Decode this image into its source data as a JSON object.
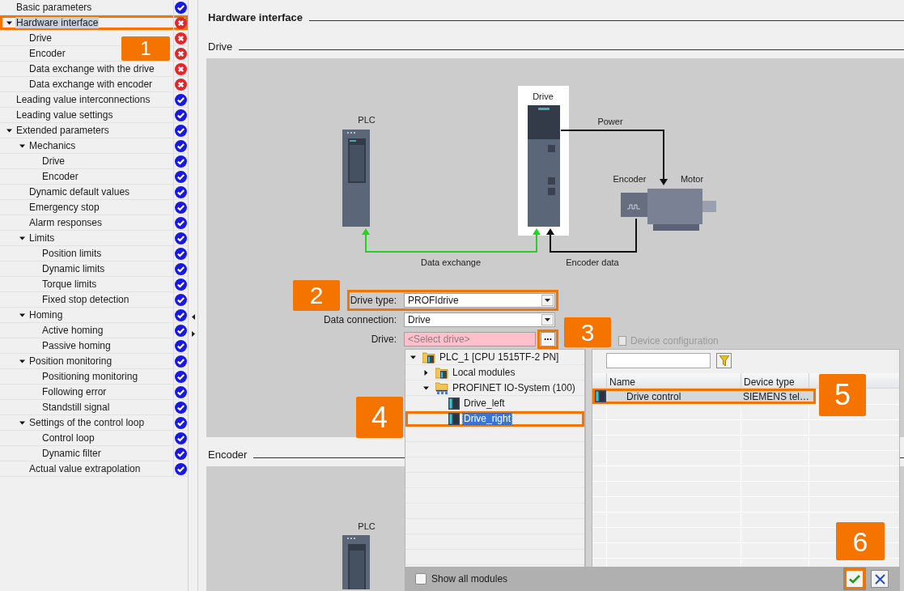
{
  "sidebar": {
    "items": [
      {
        "label": "Basic parameters",
        "error": false,
        "selected": false,
        "highlighted": false
      },
      {
        "label": "Hardware interface",
        "error": true,
        "selected": true,
        "highlighted": true,
        "expanded": true,
        "children": [
          {
            "label": "Drive",
            "error": true,
            "selected": false,
            "highlighted": false
          },
          {
            "label": "Encoder",
            "error": true,
            "selected": false,
            "highlighted": false
          },
          {
            "label": "Data exchange with the drive",
            "error": true,
            "selected": false,
            "highlighted": false
          },
          {
            "label": "Data exchange with encoder",
            "error": true,
            "selected": false,
            "highlighted": false
          }
        ]
      },
      {
        "label": "Leading value interconnections",
        "error": false,
        "selected": false,
        "highlighted": false
      },
      {
        "label": "Leading value settings",
        "error": false,
        "selected": false,
        "highlighted": false
      },
      {
        "label": "Extended parameters",
        "error": false,
        "selected": false,
        "highlighted": false,
        "expanded": true,
        "children": [
          {
            "label": "Mechanics",
            "error": false,
            "selected": false,
            "highlighted": false,
            "expanded": true,
            "children": [
              {
                "label": "Drive",
                "error": false,
                "selected": false,
                "highlighted": false
              },
              {
                "label": "Encoder",
                "error": false,
                "selected": false,
                "highlighted": false
              }
            ]
          },
          {
            "label": "Dynamic default values",
            "error": false,
            "selected": false,
            "highlighted": false
          },
          {
            "label": "Emergency stop",
            "error": false,
            "selected": false,
            "highlighted": false
          },
          {
            "label": "Alarm responses",
            "error": false,
            "selected": false,
            "highlighted": false
          },
          {
            "label": "Limits",
            "error": false,
            "selected": false,
            "highlighted": false,
            "expanded": true,
            "children": [
              {
                "label": "Position limits",
                "error": false,
                "selected": false,
                "highlighted": false
              },
              {
                "label": "Dynamic limits",
                "error": false,
                "selected": false,
                "highlighted": false
              },
              {
                "label": "Torque limits",
                "error": false,
                "selected": false,
                "highlighted": false
              },
              {
                "label": "Fixed stop detection",
                "error": false,
                "selected": false,
                "highlighted": false
              }
            ]
          },
          {
            "label": "Homing",
            "error": false,
            "selected": false,
            "highlighted": false,
            "expanded": true,
            "children": [
              {
                "label": "Active homing",
                "error": false,
                "selected": false,
                "highlighted": false
              },
              {
                "label": "Passive homing",
                "error": false,
                "selected": false,
                "highlighted": false
              }
            ]
          },
          {
            "label": "Position monitoring",
            "error": false,
            "selected": false,
            "highlighted": false,
            "expanded": true,
            "children": [
              {
                "label": "Positioning monitoring",
                "error": false,
                "selected": false,
                "highlighted": false
              },
              {
                "label": "Following error",
                "error": false,
                "selected": false,
                "highlighted": false
              },
              {
                "label": "Standstill signal",
                "error": false,
                "selected": false,
                "highlighted": false
              }
            ]
          },
          {
            "label": "Settings of the control loop",
            "error": false,
            "selected": false,
            "highlighted": false,
            "expanded": true,
            "children": [
              {
                "label": "Control loop",
                "error": false,
                "selected": false,
                "highlighted": false
              },
              {
                "label": "Dynamic filter",
                "error": false,
                "selected": false,
                "highlighted": false
              }
            ]
          },
          {
            "label": "Actual value extrapolation",
            "error": false,
            "selected": false,
            "highlighted": false
          }
        ]
      }
    ]
  },
  "header": {
    "title": "Hardware interface"
  },
  "drive_section": {
    "title": "Drive",
    "diagram": {
      "plc": "PLC",
      "drive": "Drive",
      "power": "Power",
      "encoder": "Encoder",
      "motor": "Motor",
      "data_exchange": "Data exchange",
      "encoder_data": "Encoder data"
    },
    "form": {
      "fields": [
        {
          "label": "Drive type:",
          "kind": "combo",
          "value": "PROFIdrive",
          "highlighted": true
        },
        {
          "label": "Data connection:",
          "kind": "combo",
          "value": "Drive",
          "highlighted": false
        },
        {
          "label": "Drive:",
          "kind": "browse",
          "placeholder": "<Select drive>",
          "invalid": true,
          "highlighted": false,
          "button": {
            "label": "...",
            "highlighted": true
          }
        }
      ]
    }
  },
  "encoder_section": {
    "title": "Encoder",
    "diagram": {
      "plc": "PLC"
    }
  },
  "popup": {
    "tab": {
      "label": "Device configuration",
      "disabled": true
    },
    "tree": [
      {
        "label": "PLC_1 [CPU 1515TF-2 PN]",
        "kind": "plc",
        "expanded": true,
        "selected": false,
        "highlighted": false,
        "children": [
          {
            "label": "Local modules",
            "kind": "folder",
            "expanded": false,
            "selected": false,
            "highlighted": false
          },
          {
            "label": "PROFINET IO-System (100)",
            "kind": "network",
            "expanded": true,
            "selected": false,
            "highlighted": false,
            "children": [
              {
                "label": "Drive_left",
                "kind": "device",
                "selected": false,
                "highlighted": false
              },
              {
                "label": "Drive_right",
                "kind": "device",
                "selected": true,
                "highlighted": true
              }
            ]
          }
        ]
      }
    ],
    "table": {
      "columns": [
        "Name",
        "Device type"
      ],
      "rows": [
        {
          "name": "Drive control",
          "device_type": "SIEMENS tel…",
          "selected": true,
          "highlighted": true
        }
      ]
    },
    "show_all_modules": {
      "label": "Show all modules",
      "checked": false
    },
    "buttons": [
      {
        "kind": "confirm",
        "highlighted": true
      },
      {
        "kind": "cancel",
        "highlighted": false
      }
    ]
  },
  "callouts": [
    {
      "label": "1"
    },
    {
      "label": "2"
    },
    {
      "label": "3"
    },
    {
      "label": "4"
    },
    {
      "label": "5"
    },
    {
      "label": "6"
    }
  ]
}
